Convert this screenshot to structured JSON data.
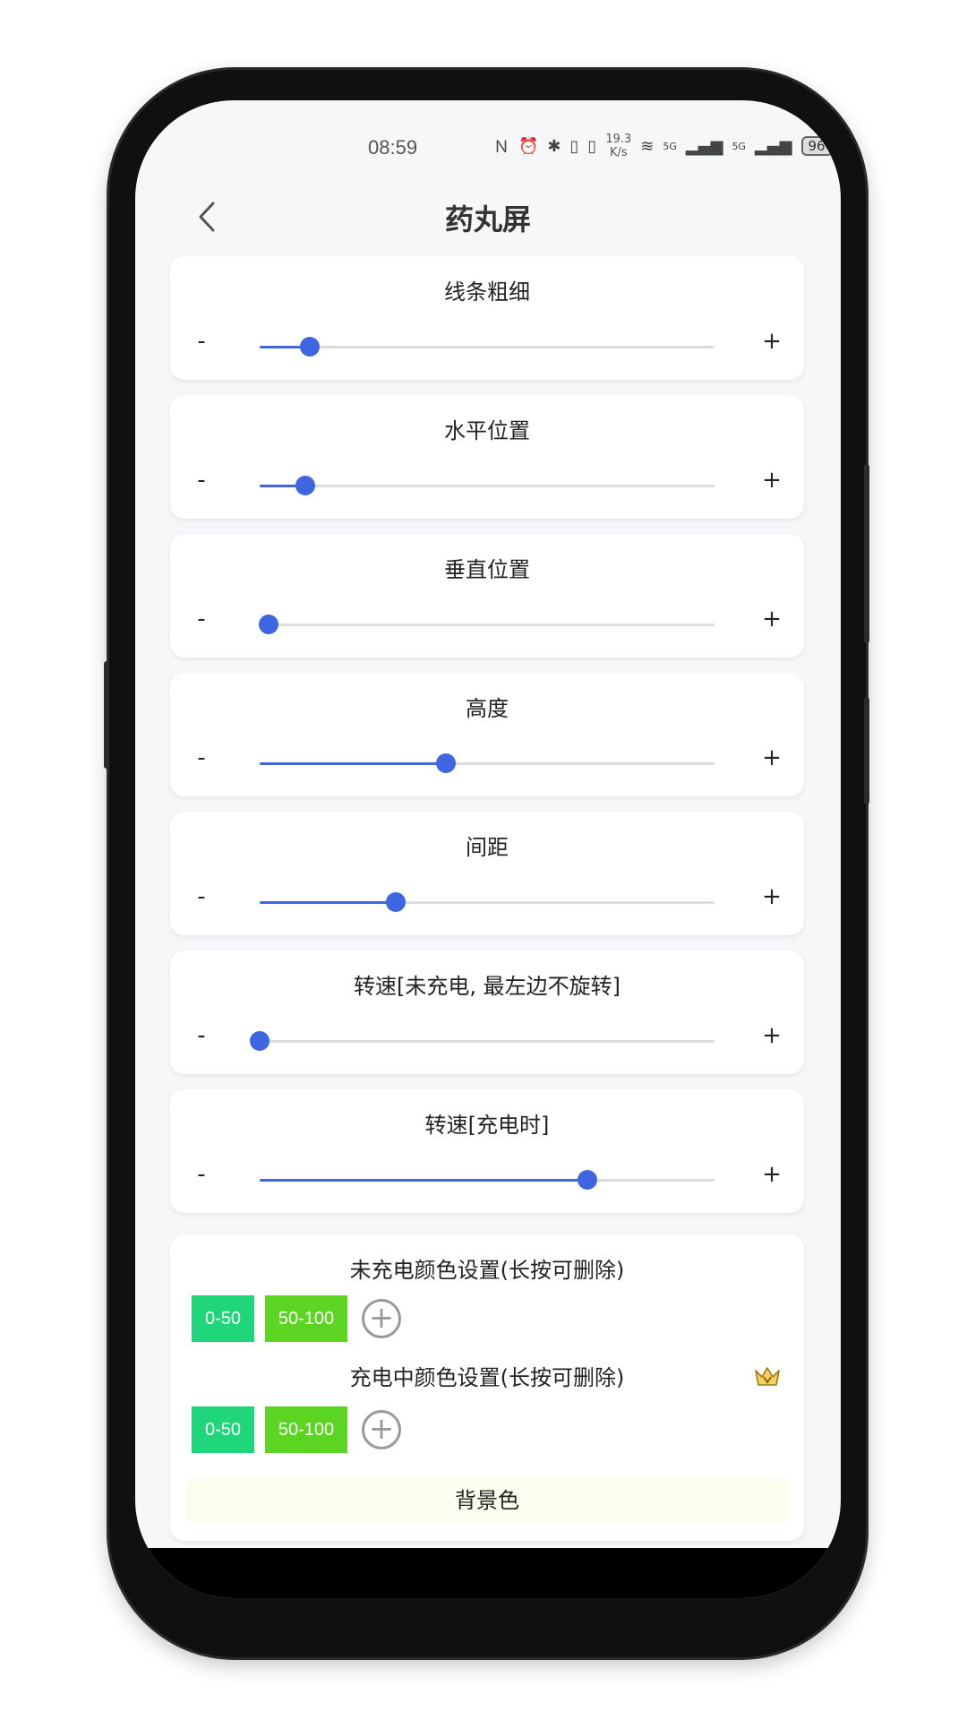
{
  "status_bar": {
    "time": "08:59",
    "icons": [
      "nfc-icon",
      "alarm-icon",
      "bluetooth-icon",
      "battery-saver-icon",
      "vibrate-icon"
    ],
    "speed_value": "19.3",
    "speed_unit": "K/s",
    "signal_1": "5G",
    "signal_2": "5G",
    "battery": "96"
  },
  "header": {
    "title": "药丸屏"
  },
  "sliders": [
    {
      "label": "线条粗细",
      "minus": "-",
      "plus": "+",
      "value_percent": 11
    },
    {
      "label": "水平位置",
      "minus": "-",
      "plus": "+",
      "value_percent": 10
    },
    {
      "label": "垂直位置",
      "minus": "-",
      "plus": "+",
      "value_percent": 2
    },
    {
      "label": "高度",
      "minus": "-",
      "plus": "+",
      "value_percent": 41
    },
    {
      "label": "间距",
      "minus": "-",
      "plus": "+",
      "value_percent": 30
    },
    {
      "label": "转速[未充电, 最左边不旋转]",
      "minus": "-",
      "plus": "+",
      "value_percent": 0
    },
    {
      "label": "转速[充电时]",
      "minus": "-",
      "plus": "+",
      "value_percent": 72
    }
  ],
  "colors": {
    "uncharged_title": "未充电颜色设置(长按可删除)",
    "charging_title": "充电中颜色设置(长按可删除)",
    "uncharged_chips": [
      {
        "label": "0-50",
        "color": "#1fd67a"
      },
      {
        "label": "50-100",
        "color": "#5bd522"
      }
    ],
    "charging_chips": [
      {
        "label": "0-50",
        "color": "#1fd67a"
      },
      {
        "label": "50-100",
        "color": "#5bd522"
      }
    ],
    "add_symbol": "+",
    "background_label": "背景色"
  },
  "accent_color": "#3d66e0"
}
